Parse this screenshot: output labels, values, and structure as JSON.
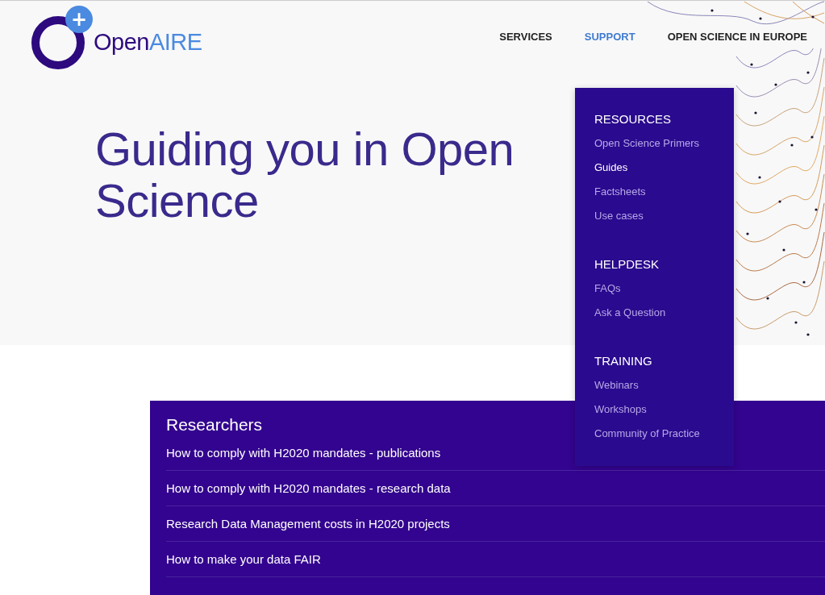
{
  "logo": {
    "text_dark": "Open",
    "text_light": "AIRE",
    "badge": "+"
  },
  "nav": [
    {
      "label": "SERVICES",
      "selected": false
    },
    {
      "label": "SUPPORT",
      "selected": true
    },
    {
      "label": "OPEN SCIENCE IN EUROPE",
      "selected": false
    }
  ],
  "hero": {
    "title": "Guiding you in Open Science"
  },
  "dropdown": {
    "sections": [
      {
        "heading": "RESOURCES",
        "items": [
          {
            "label": "Open Science Primers",
            "selected": false
          },
          {
            "label": "Guides",
            "selected": true
          },
          {
            "label": "Factsheets",
            "selected": false
          },
          {
            "label": "Use cases",
            "selected": false
          }
        ]
      },
      {
        "heading": "HELPDESK",
        "items": [
          {
            "label": "FAQs",
            "selected": false
          },
          {
            "label": "Ask a Question",
            "selected": false
          }
        ]
      },
      {
        "heading": "TRAINING",
        "items": [
          {
            "label": "Webinars",
            "selected": false
          },
          {
            "label": "Workshops",
            "selected": false
          },
          {
            "label": "Community of Practice",
            "selected": false
          }
        ]
      }
    ]
  },
  "panel": {
    "title": "Researchers",
    "links": [
      "How to comply with H2020 mandates - publications",
      "How to comply with H2020 mandates - research data",
      "Research Data Management costs in H2020 projects",
      "How to make your data FAIR"
    ]
  }
}
